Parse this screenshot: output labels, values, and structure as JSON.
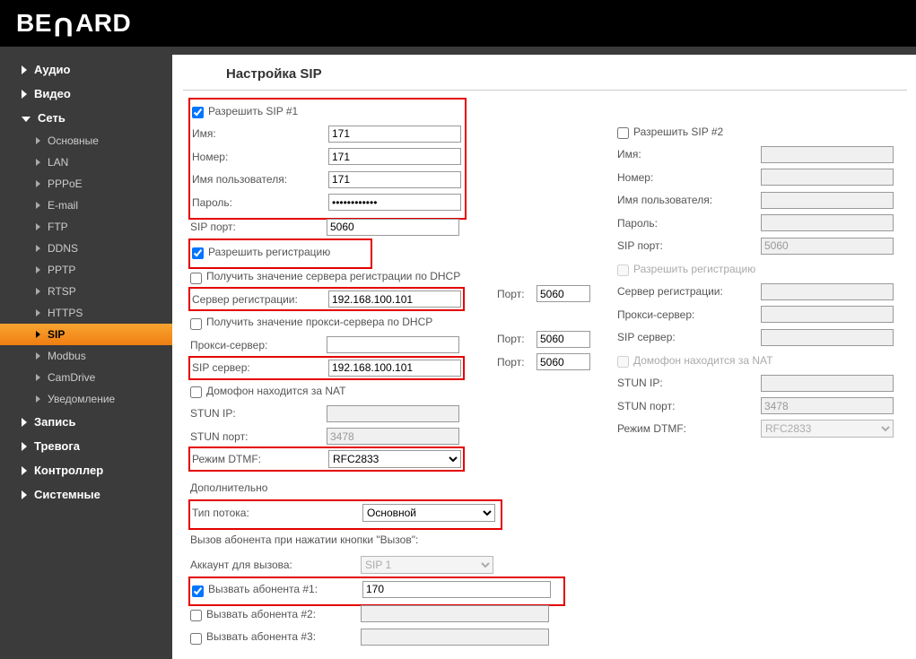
{
  "brand": "BEWARD",
  "page_title": "Настройка SIP",
  "nav": {
    "audio": "Аудио",
    "video": "Видео",
    "network": "Сеть",
    "network_items": {
      "basic": "Основные",
      "lan": "LAN",
      "pppoe": "PPPoE",
      "email": "E-mail",
      "ftp": "FTP",
      "ddns": "DDNS",
      "pptp": "PPTP",
      "rtsp": "RTSP",
      "https": "HTTPS",
      "sip": "SIP",
      "modbus": "Modbus",
      "camdrive": "CamDrive",
      "notify": "Уведомление"
    },
    "record": "Запись",
    "alarm": "Тревога",
    "controller": "Контроллер",
    "system": "Системные"
  },
  "sip1": {
    "enable": "Разрешить SIP #1",
    "name_l": "Имя:",
    "name": "171",
    "num_l": "Номер:",
    "num": "171",
    "user_l": "Имя пользователя:",
    "user": "171",
    "pass_l": "Пароль:",
    "pass": "••••••••••••",
    "sipport_l": "SIP порт:",
    "sipport": "5060",
    "reg": "Разрешить регистрацию",
    "dhcp_reg": "Получить значение сервера регистрации по DHCP",
    "regsrv_l": "Сервер регистрации:",
    "regsrv": "192.168.100.101",
    "port_l": "Порт:",
    "regport": "5060",
    "dhcp_proxy": "Получить значение прокси-сервера по DHCP",
    "proxy_l": "Прокси-сервер:",
    "proxy": "",
    "proxyport": "5060",
    "sipsrv_l": "SIP сервер:",
    "sipsrv": "192.168.100.101",
    "sipsrvport": "5060",
    "nat": "Домофон находится за NAT",
    "stunip_l": "STUN IP:",
    "stunip": "",
    "stunport_l": "STUN порт:",
    "stunport": "3478",
    "dtmf_l": "Режим DTMF:",
    "dtmf": "RFC2833"
  },
  "sip2": {
    "enable": "Разрешить SIP #2",
    "name_l": "Имя:",
    "num_l": "Номер:",
    "user_l": "Имя пользователя:",
    "pass_l": "Пароль:",
    "sipport_l": "SIP порт:",
    "sipport": "5060",
    "reg": "Разрешить регистрацию",
    "regsrv_l": "Сервер регистрации:",
    "proxy_l": "Прокси-сервер:",
    "sipsrv_l": "SIP сервер:",
    "nat": "Домофон находится за NAT",
    "stunip_l": "STUN IP:",
    "stunport_l": "STUN порт:",
    "stunport": "3478",
    "dtmf_l": "Режим DTMF:",
    "dtmf": "RFC2833"
  },
  "extra": {
    "title": "Дополнительно",
    "stream_l": "Тип потока:",
    "stream": "Основной",
    "callbtn": "Вызов абонента при нажатии кнопки \"Вызов\":",
    "acct_l": "Аккаунт для вызова:",
    "acct": "SIP 1",
    "call1": "Вызвать абонента #1:",
    "call1v": "170",
    "call2": "Вызвать абонента #2:",
    "call3": "Вызвать абонента #3:"
  }
}
